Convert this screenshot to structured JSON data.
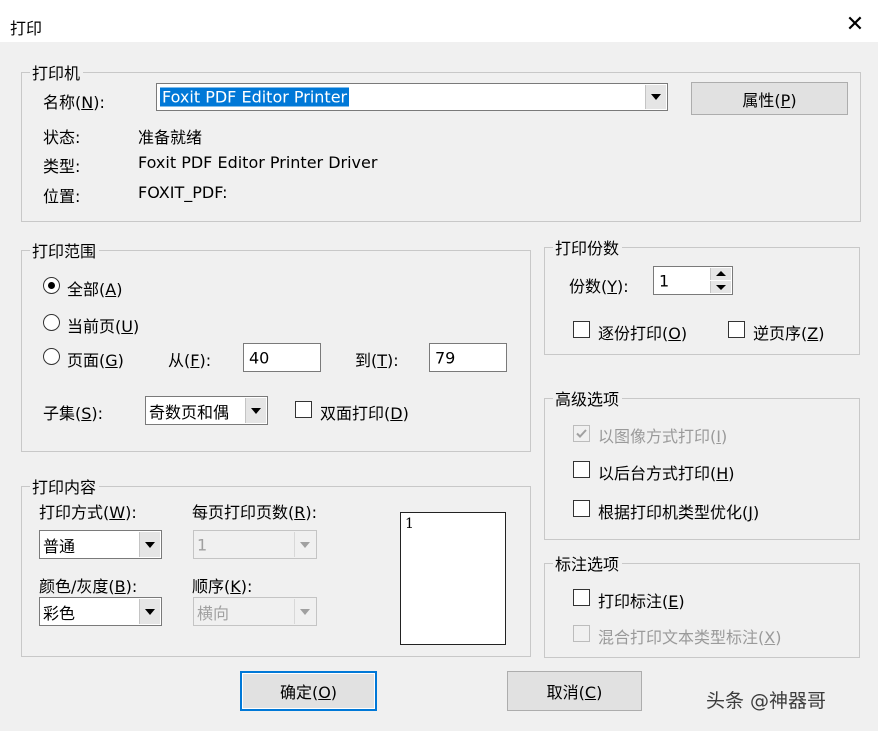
{
  "window": {
    "title": "打印",
    "close_glyph": "✕"
  },
  "printer": {
    "group_label": "打印机",
    "name_label": "名称(",
    "name_key": "N",
    "name_suffix": "):",
    "name_value": "Foxit PDF Editor Printer",
    "props_label": "属性(",
    "props_key": "P",
    "props_suffix": ")",
    "status_label": "状态:",
    "status_value": "准备就绪",
    "type_label": "类型:",
    "type_value": "Foxit PDF Editor Printer Driver",
    "location_label": "位置:",
    "location_value": "FOXIT_PDF:"
  },
  "range": {
    "group_label": "打印范围",
    "all": {
      "text": "全部(",
      "key": "A",
      "suffix": ")",
      "checked": true
    },
    "current": {
      "text": "当前页(",
      "key": "U",
      "suffix": ")"
    },
    "pages": {
      "text": "页面(",
      "key": "G",
      "suffix": ")"
    },
    "from_label": "从(",
    "from_key": "F",
    "from_suffix": "):",
    "from_value": "40",
    "to_label": "到(",
    "to_key": "T",
    "to_suffix": "):",
    "to_value": "79",
    "subset_label": "子集(",
    "subset_key": "S",
    "subset_suffix": "):",
    "subset_value": "奇数页和偶",
    "duplex_label": "双面打印(",
    "duplex_key": "D",
    "duplex_suffix": ")"
  },
  "content": {
    "group_label": "打印内容",
    "mode_label": "打印方式(",
    "mode_key": "W",
    "mode_suffix": "):",
    "mode_value": "普通",
    "perpage_label": "每页打印页数(",
    "perpage_key": "R",
    "perpage_suffix": "):",
    "perpage_value": "1",
    "color_label": "颜色/灰度(",
    "color_key": "B",
    "color_suffix": "):",
    "color_value": "彩色",
    "order_label": "顺序(",
    "order_key": "K",
    "order_suffix": "):",
    "order_value": "横向",
    "preview_number": "1"
  },
  "copies": {
    "group_label": "打印份数",
    "count_label": "份数(",
    "count_key": "Y",
    "count_suffix": "):",
    "count_value": "1",
    "collate_label": "逐份打印(",
    "collate_key": "O",
    "collate_suffix": ")",
    "reverse_label": "逆页序(",
    "reverse_key": "Z",
    "reverse_suffix": ")"
  },
  "advanced": {
    "group_label": "高级选项",
    "as_image_label": "以图像方式打印(",
    "as_image_key": "I",
    "as_image_suffix": ")",
    "background_label": "以后台方式打印(",
    "background_key": "H",
    "background_suffix": ")",
    "optimize_label": "根据打印机类型优化(",
    "optimize_key": "J",
    "optimize_suffix": ")"
  },
  "annotation": {
    "group_label": "标注选项",
    "print_annots_label": "打印标注(",
    "print_annots_key": "E",
    "print_annots_suffix": ")",
    "mixed_label": "混合打印文本类型标注(",
    "mixed_key": "X",
    "mixed_suffix": ")"
  },
  "buttons": {
    "ok": "确定(",
    "ok_key": "O",
    "ok_suffix": ")",
    "cancel": "取消(",
    "cancel_key": "C",
    "cancel_suffix": ")"
  },
  "watermark": "头条 @神器哥",
  "colors": {
    "selection": "#0078d7",
    "default_button_border": "#0078d7"
  }
}
